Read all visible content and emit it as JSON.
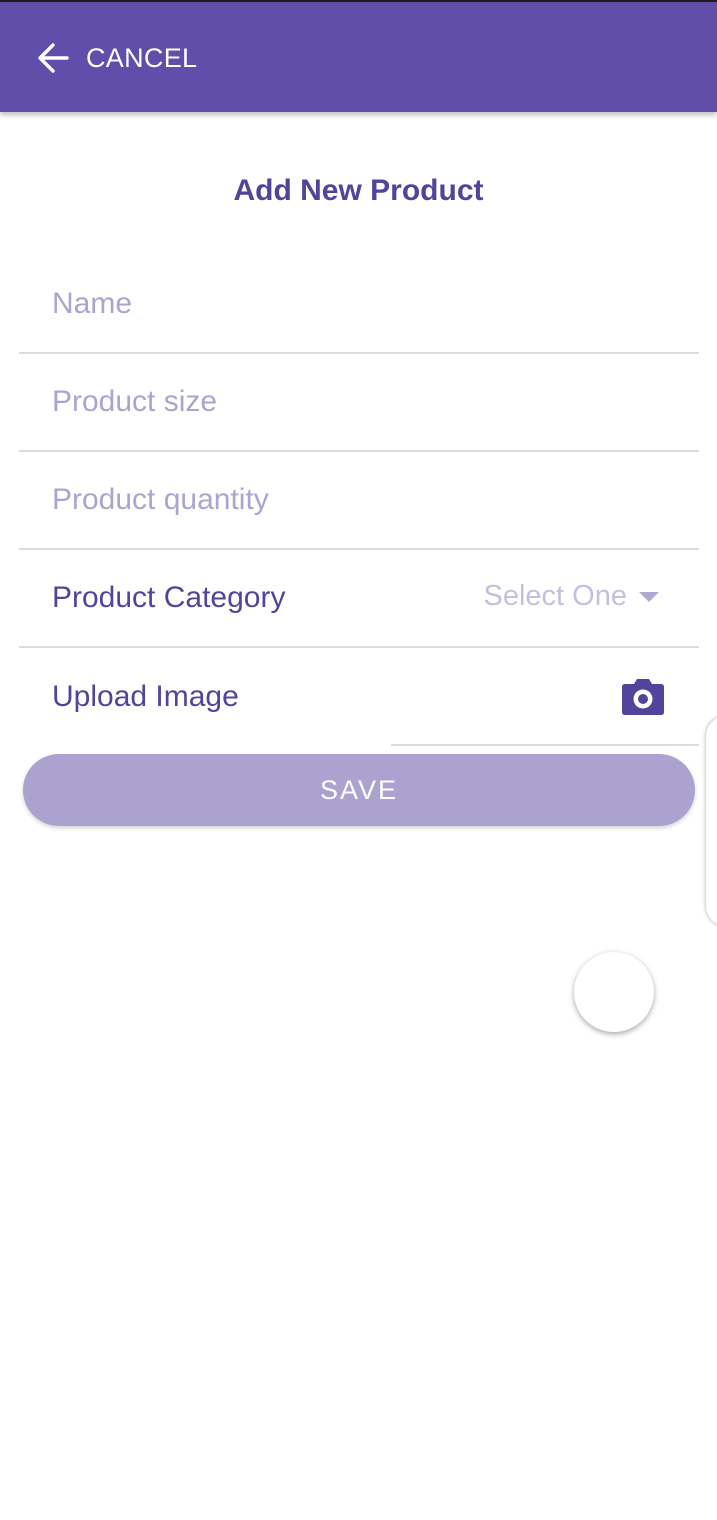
{
  "appbar": {
    "cancel_label": "CANCEL",
    "back_icon": "arrow-left-icon",
    "background_color": "#604eab"
  },
  "page": {
    "title": "Add New Product"
  },
  "form": {
    "name_placeholder": "Name",
    "size_placeholder": "Product size",
    "quantity_placeholder": "Product quantity",
    "category_label": "Product Category",
    "category_selected": "Select One",
    "upload_label": "Upload Image",
    "camera_icon": "camera-icon",
    "save_label": "SAVE"
  },
  "colors": {
    "accent": "#52449b",
    "placeholder": "#aea3cf",
    "save_button": "#aca2cf"
  }
}
